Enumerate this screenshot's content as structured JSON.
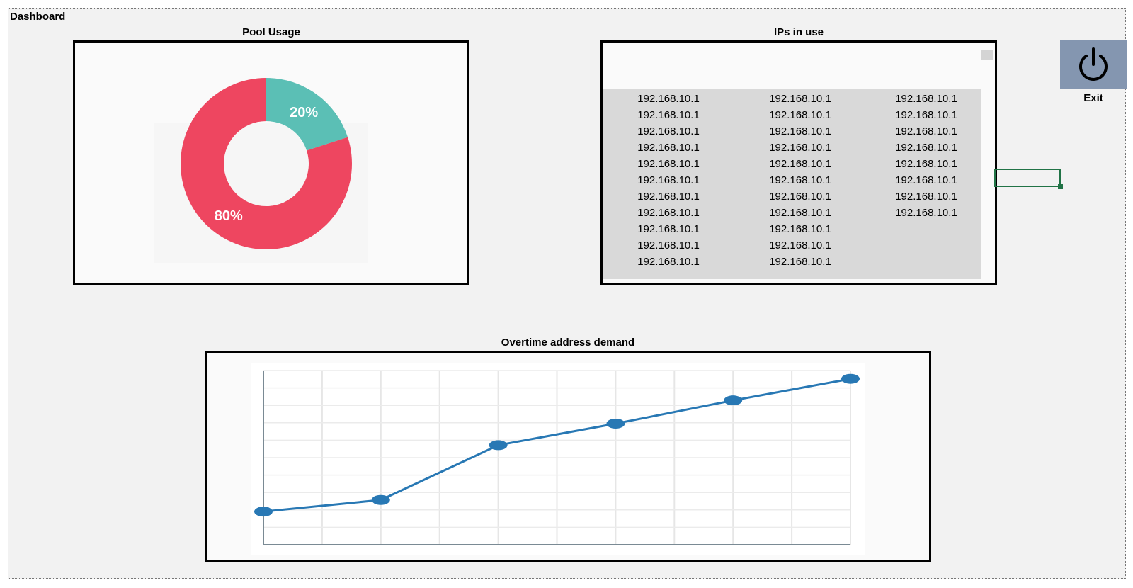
{
  "window": {
    "title": "Dashboard"
  },
  "pool_usage": {
    "title": "Pool Usage",
    "chart_data": {
      "type": "pie",
      "labels": [
        "20%",
        "80%"
      ],
      "values": [
        20,
        80
      ],
      "colors": [
        "#5bbfb5",
        "#ee4660"
      ]
    }
  },
  "ips": {
    "title": "IPs in use",
    "columns": [
      [
        "192.168.10.1",
        "192.168.10.1",
        "192.168.10.1",
        "192.168.10.1",
        "192.168.10.1",
        "192.168.10.1",
        "192.168.10.1",
        "192.168.10.1",
        "192.168.10.1",
        "192.168.10.1",
        "192.168.10.1"
      ],
      [
        "192.168.10.1",
        "192.168.10.1",
        "192.168.10.1",
        "192.168.10.1",
        "192.168.10.1",
        "192.168.10.1",
        "192.168.10.1",
        "192.168.10.1",
        "192.168.10.1",
        "192.168.10.1",
        "192.168.10.1"
      ],
      [
        "192.168.10.1",
        "192.168.10.1",
        "192.168.10.1",
        "192.168.10.1",
        "192.168.10.1",
        "192.168.10.1",
        "192.168.10.1",
        "192.168.10.1"
      ]
    ]
  },
  "exit": {
    "label": "Exit",
    "icon": "power-icon",
    "color": "#8496b0"
  },
  "demand": {
    "title": "Overtime address demand",
    "chart_data": {
      "type": "line",
      "x": [
        0,
        2,
        4,
        6,
        8,
        10
      ],
      "values": [
        2,
        2.7,
        6,
        7.3,
        8.7,
        10
      ],
      "xlim": [
        0,
        10
      ],
      "ylim": [
        0,
        10.5
      ],
      "grid": true,
      "color": "#2878b4"
    }
  }
}
